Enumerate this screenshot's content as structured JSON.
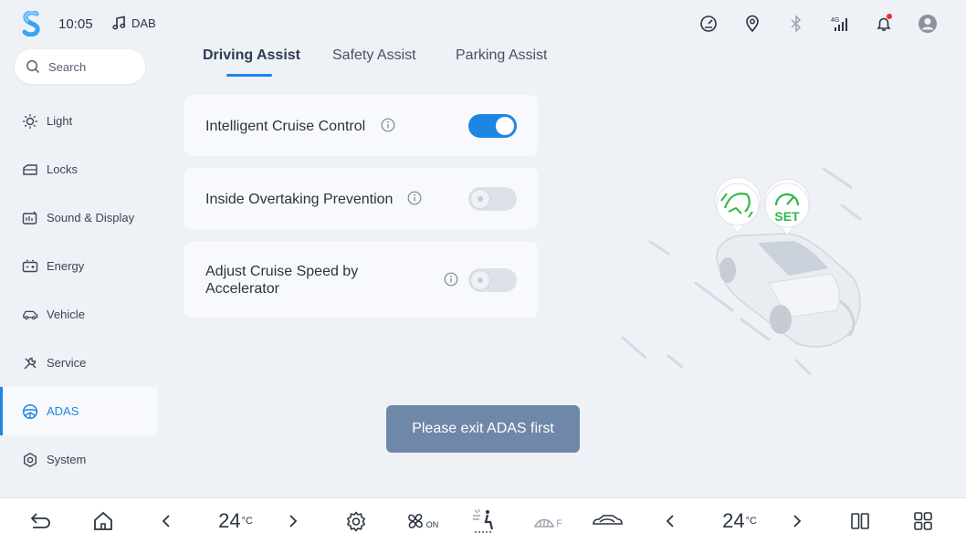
{
  "status": {
    "time": "10:05",
    "audio_source": "DAB",
    "icons": [
      "speedometer-icon",
      "location-icon",
      "bluetooth-icon",
      "4g-signal-icon",
      "bell-icon",
      "profile-icon"
    ],
    "network_label": "4G"
  },
  "search": {
    "placeholder": "Search"
  },
  "sidebar": {
    "items": [
      {
        "label": "Light",
        "icon": "light-icon"
      },
      {
        "label": "Locks",
        "icon": "door-icon"
      },
      {
        "label": "Sound & Display",
        "icon": "sound-display-icon"
      },
      {
        "label": "Energy",
        "icon": "battery-icon"
      },
      {
        "label": "Vehicle",
        "icon": "car-icon"
      },
      {
        "label": "Service",
        "icon": "wrench-icon"
      },
      {
        "label": "ADAS",
        "icon": "adas-wheel-icon"
      },
      {
        "label": "System",
        "icon": "system-icon"
      }
    ],
    "active": "ADAS"
  },
  "tabs": [
    {
      "label": "Driving Assist",
      "selected": true
    },
    {
      "label": "Safety Assist",
      "selected": false
    },
    {
      "label": "Parking Assist",
      "selected": false
    }
  ],
  "settings": [
    {
      "label": "Intelligent Cruise Control",
      "enabled": true
    },
    {
      "label": "Inside Overtaking Prevention",
      "enabled": false
    },
    {
      "label_line1": "Adjust Cruise Speed by",
      "label_line2": "Accelerator",
      "enabled": false
    }
  ],
  "illustration": {
    "badge_text": "SET"
  },
  "toast": {
    "message": "Please exit ADAS first"
  },
  "bottom_bar": {
    "left_temp": "24",
    "right_temp": "24",
    "temp_unit": "°C",
    "fan_label": "ON",
    "defrost_label": "F"
  },
  "colors": {
    "accent": "#1e86e2",
    "toast_bg": "#6f87a8",
    "badge_green": "#2db84a",
    "notification_dot": "#e5322d"
  }
}
